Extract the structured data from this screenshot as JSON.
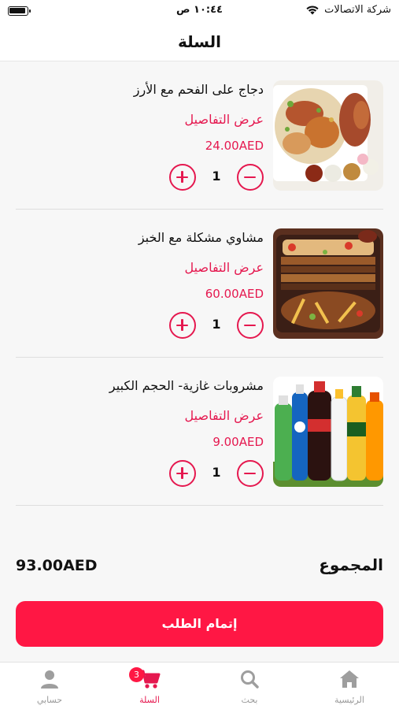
{
  "status_bar": {
    "carrier": "شركة الاتصالات",
    "time": "١٠:٤٤ ص"
  },
  "header": {
    "title": "السلة"
  },
  "cart": {
    "items": [
      {
        "name": "دجاج على الفحم مع الأرز",
        "details_label": "عرض التفاصيل",
        "price": "24.00AED",
        "quantity": "1"
      },
      {
        "name": "مشاوي مشكلة مع الخبز",
        "details_label": "عرض التفاصيل",
        "price": "60.00AED",
        "quantity": "1"
      },
      {
        "name": "مشروبات غازية- الحجم الكبير",
        "details_label": "عرض التفاصيل",
        "price": "9.00AED",
        "quantity": "1"
      }
    ]
  },
  "summary": {
    "total_label": "المجموع",
    "total_value": "93.00AED"
  },
  "checkout": {
    "label": "إتمام الطلب"
  },
  "tabbar": {
    "tabs": [
      {
        "label": "الرئيسية",
        "icon": "home-icon"
      },
      {
        "label": "بحث",
        "icon": "search-icon"
      },
      {
        "label": "السلة",
        "icon": "cart-icon",
        "badge": "3",
        "active": true
      },
      {
        "label": "حسابي",
        "icon": "user-icon"
      }
    ]
  },
  "colors": {
    "accent": "#e5184f",
    "button": "#ff1744",
    "background": "#f7f7f7"
  }
}
